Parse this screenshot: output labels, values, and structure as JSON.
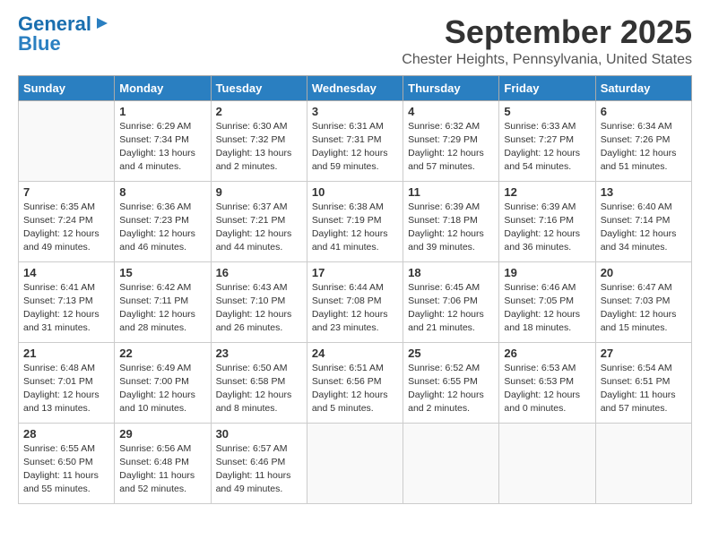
{
  "logo": {
    "line1": "General",
    "line2": "Blue"
  },
  "title": "September 2025",
  "location": "Chester Heights, Pennsylvania, United States",
  "days_header": [
    "Sunday",
    "Monday",
    "Tuesday",
    "Wednesday",
    "Thursday",
    "Friday",
    "Saturday"
  ],
  "weeks": [
    [
      {
        "num": "",
        "info": ""
      },
      {
        "num": "1",
        "info": "Sunrise: 6:29 AM\nSunset: 7:34 PM\nDaylight: 13 hours\nand 4 minutes."
      },
      {
        "num": "2",
        "info": "Sunrise: 6:30 AM\nSunset: 7:32 PM\nDaylight: 13 hours\nand 2 minutes."
      },
      {
        "num": "3",
        "info": "Sunrise: 6:31 AM\nSunset: 7:31 PM\nDaylight: 12 hours\nand 59 minutes."
      },
      {
        "num": "4",
        "info": "Sunrise: 6:32 AM\nSunset: 7:29 PM\nDaylight: 12 hours\nand 57 minutes."
      },
      {
        "num": "5",
        "info": "Sunrise: 6:33 AM\nSunset: 7:27 PM\nDaylight: 12 hours\nand 54 minutes."
      },
      {
        "num": "6",
        "info": "Sunrise: 6:34 AM\nSunset: 7:26 PM\nDaylight: 12 hours\nand 51 minutes."
      }
    ],
    [
      {
        "num": "7",
        "info": "Sunrise: 6:35 AM\nSunset: 7:24 PM\nDaylight: 12 hours\nand 49 minutes."
      },
      {
        "num": "8",
        "info": "Sunrise: 6:36 AM\nSunset: 7:23 PM\nDaylight: 12 hours\nand 46 minutes."
      },
      {
        "num": "9",
        "info": "Sunrise: 6:37 AM\nSunset: 7:21 PM\nDaylight: 12 hours\nand 44 minutes."
      },
      {
        "num": "10",
        "info": "Sunrise: 6:38 AM\nSunset: 7:19 PM\nDaylight: 12 hours\nand 41 minutes."
      },
      {
        "num": "11",
        "info": "Sunrise: 6:39 AM\nSunset: 7:18 PM\nDaylight: 12 hours\nand 39 minutes."
      },
      {
        "num": "12",
        "info": "Sunrise: 6:39 AM\nSunset: 7:16 PM\nDaylight: 12 hours\nand 36 minutes."
      },
      {
        "num": "13",
        "info": "Sunrise: 6:40 AM\nSunset: 7:14 PM\nDaylight: 12 hours\nand 34 minutes."
      }
    ],
    [
      {
        "num": "14",
        "info": "Sunrise: 6:41 AM\nSunset: 7:13 PM\nDaylight: 12 hours\nand 31 minutes."
      },
      {
        "num": "15",
        "info": "Sunrise: 6:42 AM\nSunset: 7:11 PM\nDaylight: 12 hours\nand 28 minutes."
      },
      {
        "num": "16",
        "info": "Sunrise: 6:43 AM\nSunset: 7:10 PM\nDaylight: 12 hours\nand 26 minutes."
      },
      {
        "num": "17",
        "info": "Sunrise: 6:44 AM\nSunset: 7:08 PM\nDaylight: 12 hours\nand 23 minutes."
      },
      {
        "num": "18",
        "info": "Sunrise: 6:45 AM\nSunset: 7:06 PM\nDaylight: 12 hours\nand 21 minutes."
      },
      {
        "num": "19",
        "info": "Sunrise: 6:46 AM\nSunset: 7:05 PM\nDaylight: 12 hours\nand 18 minutes."
      },
      {
        "num": "20",
        "info": "Sunrise: 6:47 AM\nSunset: 7:03 PM\nDaylight: 12 hours\nand 15 minutes."
      }
    ],
    [
      {
        "num": "21",
        "info": "Sunrise: 6:48 AM\nSunset: 7:01 PM\nDaylight: 12 hours\nand 13 minutes."
      },
      {
        "num": "22",
        "info": "Sunrise: 6:49 AM\nSunset: 7:00 PM\nDaylight: 12 hours\nand 10 minutes."
      },
      {
        "num": "23",
        "info": "Sunrise: 6:50 AM\nSunset: 6:58 PM\nDaylight: 12 hours\nand 8 minutes."
      },
      {
        "num": "24",
        "info": "Sunrise: 6:51 AM\nSunset: 6:56 PM\nDaylight: 12 hours\nand 5 minutes."
      },
      {
        "num": "25",
        "info": "Sunrise: 6:52 AM\nSunset: 6:55 PM\nDaylight: 12 hours\nand 2 minutes."
      },
      {
        "num": "26",
        "info": "Sunrise: 6:53 AM\nSunset: 6:53 PM\nDaylight: 12 hours\nand 0 minutes."
      },
      {
        "num": "27",
        "info": "Sunrise: 6:54 AM\nSunset: 6:51 PM\nDaylight: 11 hours\nand 57 minutes."
      }
    ],
    [
      {
        "num": "28",
        "info": "Sunrise: 6:55 AM\nSunset: 6:50 PM\nDaylight: 11 hours\nand 55 minutes."
      },
      {
        "num": "29",
        "info": "Sunrise: 6:56 AM\nSunset: 6:48 PM\nDaylight: 11 hours\nand 52 minutes."
      },
      {
        "num": "30",
        "info": "Sunrise: 6:57 AM\nSunset: 6:46 PM\nDaylight: 11 hours\nand 49 minutes."
      },
      {
        "num": "",
        "info": ""
      },
      {
        "num": "",
        "info": ""
      },
      {
        "num": "",
        "info": ""
      },
      {
        "num": "",
        "info": ""
      }
    ]
  ]
}
